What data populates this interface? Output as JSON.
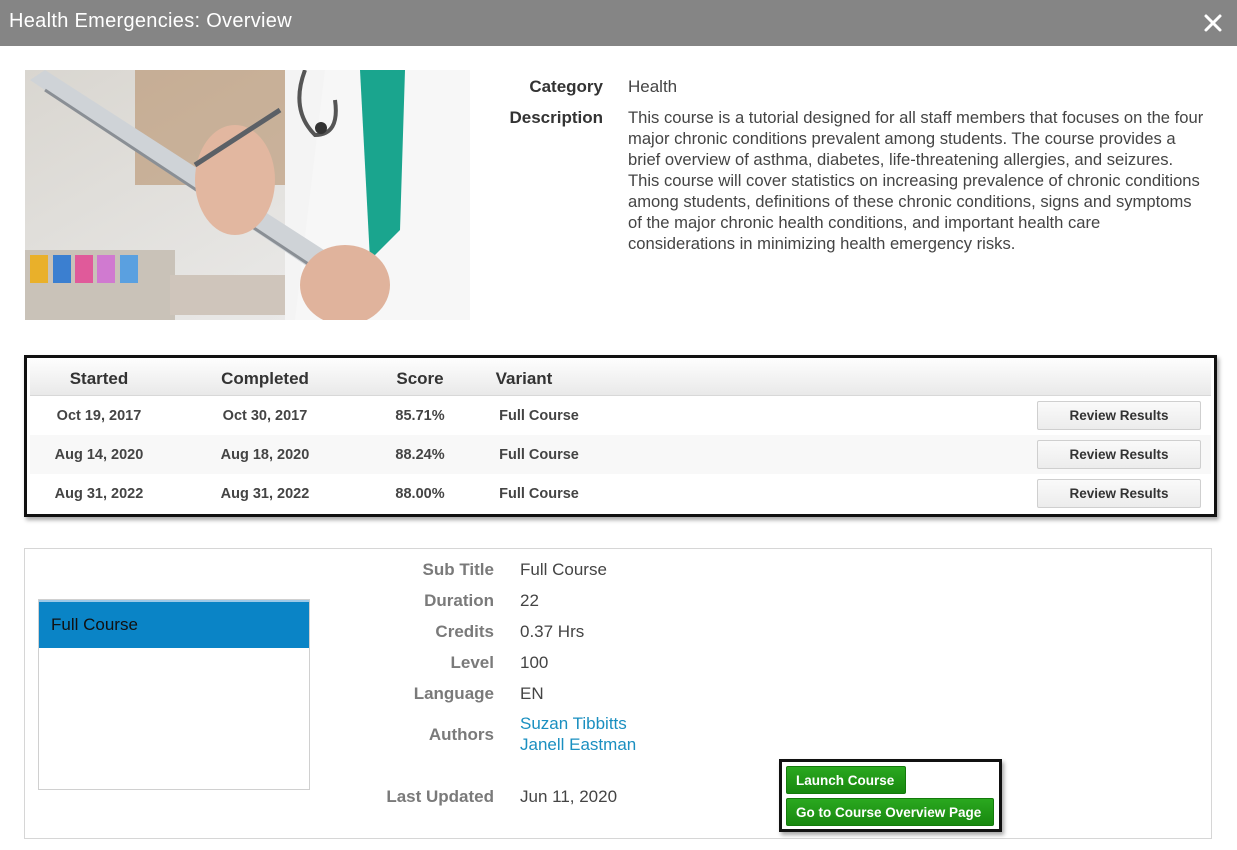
{
  "window": {
    "title": "Health Emergencies: Overview",
    "close_icon": "close-icon"
  },
  "course": {
    "image": "clipboard-doctor-photo",
    "category_label": "Category",
    "category": "Health",
    "description_label": "Description",
    "description": "This course is a tutorial designed for all staff members that focuses on the four major chronic conditions prevalent among students. The course provides a brief overview of asthma, diabetes, life-threatening allergies, and seizures. This course will cover statistics on increasing prevalence of chronic conditions among students, definitions of these chronic conditions, signs and symptoms of the major chronic health conditions, and important health care considerations in minimizing health emergency risks."
  },
  "attempts": {
    "columns": [
      "Started",
      "Completed",
      "Score",
      "Variant"
    ],
    "rows": [
      {
        "started": "Oct 19, 2017",
        "completed": "Oct 30, 2017",
        "score": "85.71%",
        "variant": "Full Course",
        "action": "Review Results"
      },
      {
        "started": "Aug 14, 2020",
        "completed": "Aug 18, 2020",
        "score": "88.24%",
        "variant": "Full Course",
        "action": "Review Results"
      },
      {
        "started": "Aug 31, 2022",
        "completed": "Aug 31, 2022",
        "score": "88.00%",
        "variant": "Full Course",
        "action": "Review Results"
      }
    ]
  },
  "variant": {
    "list": [
      "Full Course"
    ],
    "selected": "Full Course",
    "details": {
      "sub_title_label": "Sub Title",
      "sub_title": "Full Course",
      "duration_label": "Duration",
      "duration": "22",
      "credits_label": "Credits",
      "credits": "0.37 Hrs",
      "level_label": "Level",
      "level": "100",
      "language_label": "Language",
      "language": "EN",
      "authors_label": "Authors",
      "authors": [
        "Suzan Tibbitts",
        "Janell Eastman"
      ],
      "last_updated_label": "Last Updated",
      "last_updated": "Jun 11, 2020"
    },
    "actions": {
      "launch": "Launch Course",
      "overview": "Go to Course Overview Page"
    }
  },
  "colors": {
    "titlebar": "#858585",
    "selected_variant": "#0a84c6",
    "link": "#1a8fc0",
    "primary_button": "#1f9a16"
  }
}
